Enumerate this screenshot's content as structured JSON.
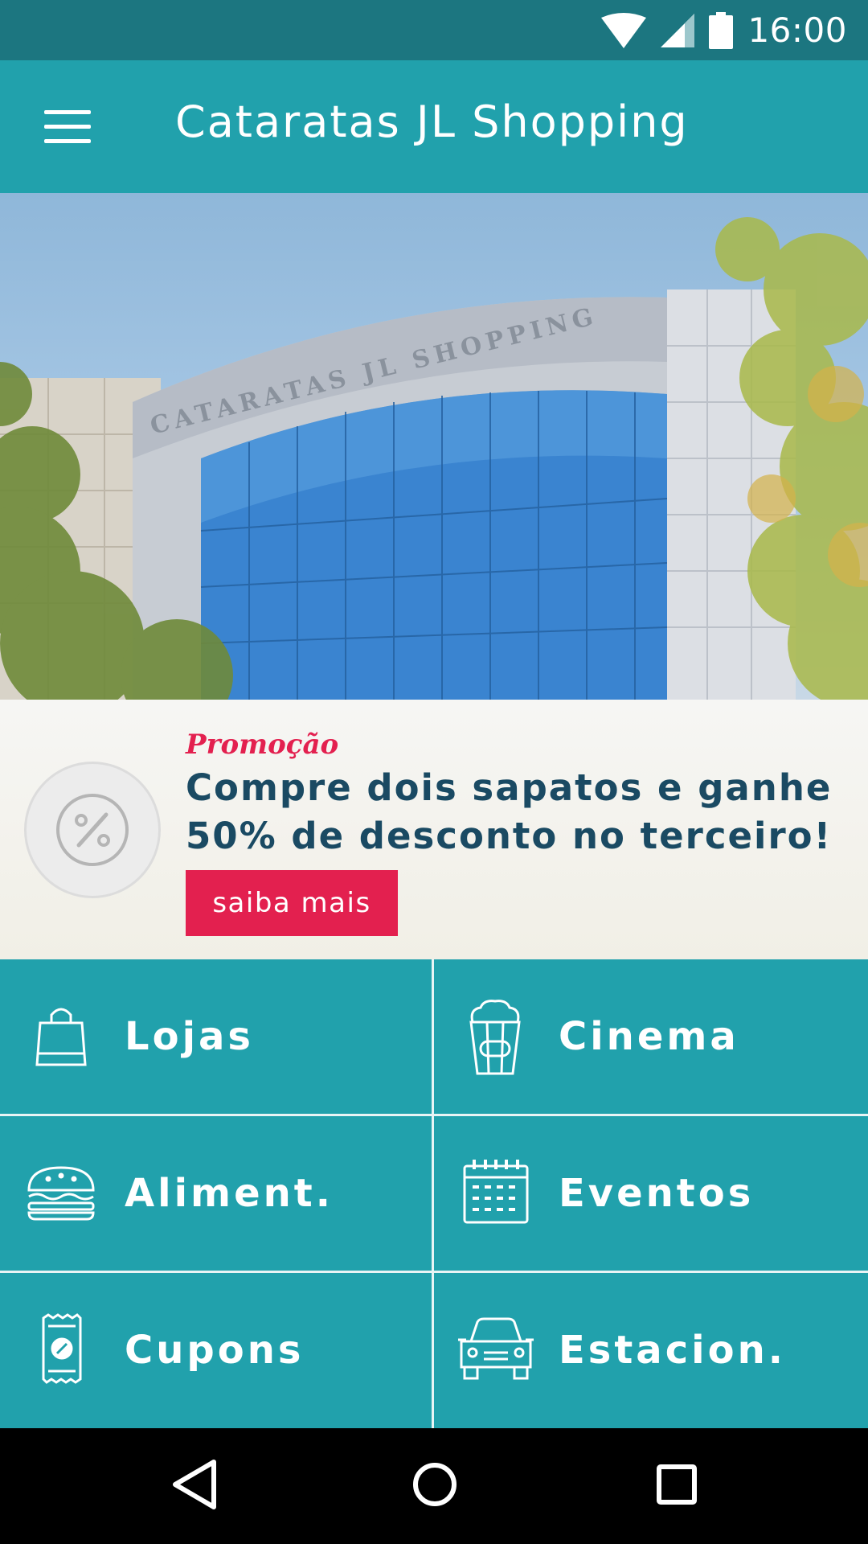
{
  "status_bar": {
    "time": "16:00",
    "icons": [
      "wifi-icon",
      "signal-icon",
      "battery-icon"
    ]
  },
  "app_bar": {
    "title": "Cataratas JL Shopping",
    "menu_icon": "menu-icon"
  },
  "hero": {
    "alt_sign": "CATARATAS JL SHOPPING"
  },
  "promo": {
    "label": "Promoção",
    "text": "Compre dois sapatos e ganhe 50% de desconto no terceiro!",
    "button": "saiba mais",
    "icon": "percent-icon"
  },
  "grid": {
    "tiles": [
      {
        "label": "Lojas",
        "icon": "shopping-bag-icon"
      },
      {
        "label": "Cinema",
        "icon": "popcorn-icon"
      },
      {
        "label": "Aliment.",
        "icon": "burger-icon"
      },
      {
        "label": "Eventos",
        "icon": "calendar-icon"
      },
      {
        "label": "Cupons",
        "icon": "coupon-icon"
      },
      {
        "label": "Estacion.",
        "icon": "car-icon"
      }
    ]
  },
  "nav_bar": {
    "buttons": [
      "back-icon",
      "home-icon",
      "recents-icon"
    ]
  },
  "colors": {
    "primary": "#21a1ac",
    "primary_dark": "#1c7680",
    "accent": "#e3204f",
    "promo_text": "#1a4a63"
  }
}
